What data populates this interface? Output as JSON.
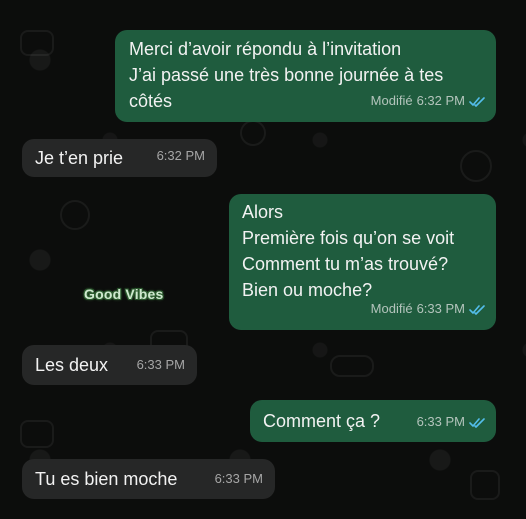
{
  "messages": [
    {
      "direction": "outgoing",
      "text": "Merci d’avoir répondu à l’invitation\nJ’ai passé une très bonne journée à tes côtés",
      "edited_label": "Modifié",
      "time": "6:32 PM",
      "read": true
    },
    {
      "direction": "incoming",
      "text": "Je t’en prie",
      "time": "6:32 PM"
    },
    {
      "direction": "outgoing",
      "text": "Alors\nPremière fois qu’on se voit\nComment tu m’as trouvé?\nBien ou moche?",
      "edited_label": "Modifié",
      "time": "6:33 PM",
      "read": true
    },
    {
      "direction": "incoming",
      "text": "Les deux",
      "time": "6:33 PM"
    },
    {
      "direction": "outgoing",
      "text": "Comment ça ?",
      "time": "6:33 PM",
      "read": true
    },
    {
      "direction": "incoming",
      "text": "Tu es bien moche",
      "time": "6:33 PM"
    }
  ],
  "sticker_text": "Good Vibes",
  "colors": {
    "outgoing_bubble": "#1f5c3e",
    "incoming_bubble": "#262727",
    "read_ticks": "#53bdeb"
  }
}
